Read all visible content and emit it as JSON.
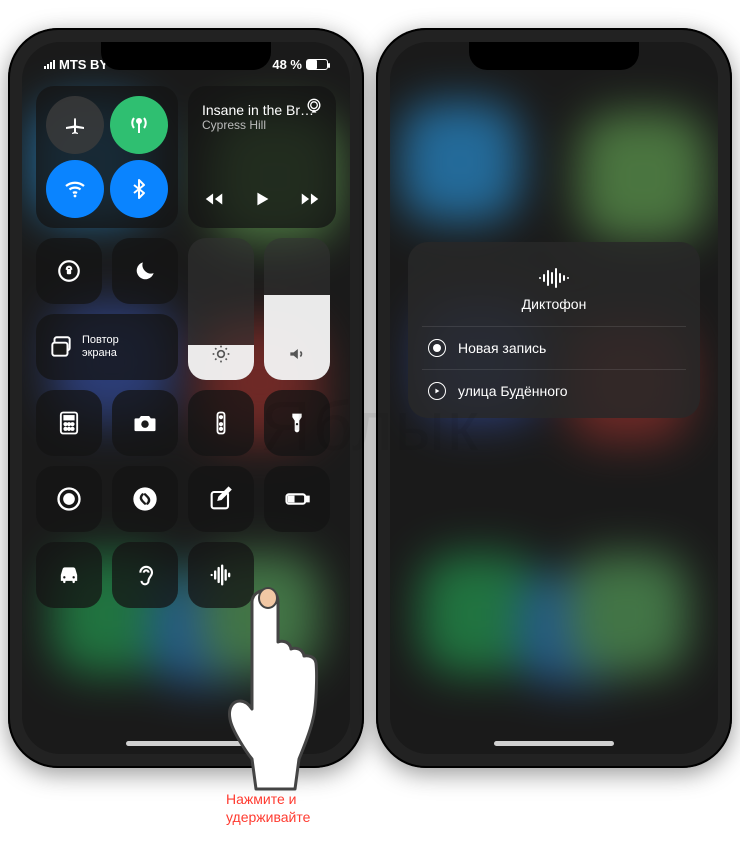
{
  "statusBar": {
    "carrier": "MTS BY",
    "batteryText": "48 %",
    "batteryLevel": 48
  },
  "connectivity": {
    "airplane": false,
    "cellular": true,
    "wifi": true,
    "bluetooth": true
  },
  "media": {
    "title": "Insane in the Br…",
    "artist": "Cypress Hill"
  },
  "screenMirror": {
    "label": "Повтор\nэкрана"
  },
  "sliders": {
    "brightness": 25,
    "volume": 60
  },
  "shortcuts": [
    {
      "id": "calculator",
      "icon": "calculator-icon"
    },
    {
      "id": "camera",
      "icon": "camera-icon"
    },
    {
      "id": "remote",
      "icon": "remote-icon"
    },
    {
      "id": "flashlight",
      "icon": "flashlight-icon"
    },
    {
      "id": "screen-record",
      "icon": "record-icon"
    },
    {
      "id": "shazam",
      "icon": "shazam-icon"
    },
    {
      "id": "notes",
      "icon": "notes-icon"
    },
    {
      "id": "low-power",
      "icon": "battery-icon"
    },
    {
      "id": "car",
      "icon": "car-icon"
    },
    {
      "id": "hearing",
      "icon": "ear-icon"
    },
    {
      "id": "voice-memos",
      "icon": "waveform-icon"
    }
  ],
  "popup": {
    "title": "Диктофон",
    "items": [
      {
        "kind": "new",
        "label": "Новая запись"
      },
      {
        "kind": "play",
        "label": "улица Будённого"
      }
    ]
  },
  "caption": "Нажмите и\nудерживайте",
  "watermark": "Яблык"
}
